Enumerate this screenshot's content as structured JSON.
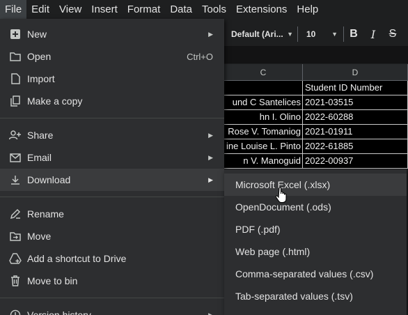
{
  "menubar": {
    "items": [
      "File",
      "Edit",
      "View",
      "Insert",
      "Format",
      "Data",
      "Tools",
      "Extensions",
      "Help"
    ]
  },
  "toolbar": {
    "font": "Default (Ari...",
    "size": "10",
    "bold": "B",
    "italic": "I",
    "strike": "S"
  },
  "grid": {
    "columns": [
      "C",
      "D"
    ],
    "header_row": [
      "",
      "Student ID Number"
    ],
    "rows": [
      [
        "und C Santelices",
        "2021-03515"
      ],
      [
        "hn I. Olino",
        "2022-60288"
      ],
      [
        "Rose V. Tomaniog",
        "2021-01911"
      ],
      [
        "ine Louise L. Pinto",
        "2022-61885"
      ],
      [
        "n V. Manoguid",
        "2022-00937"
      ]
    ]
  },
  "file_menu": {
    "new": "New",
    "open": "Open",
    "open_shortcut": "Ctrl+O",
    "import": "Import",
    "make_copy": "Make a copy",
    "share": "Share",
    "email": "Email",
    "download": "Download",
    "rename": "Rename",
    "move": "Move",
    "add_shortcut": "Add a shortcut to Drive",
    "move_to_bin": "Move to bin",
    "version_history": "Version history"
  },
  "download_menu": {
    "items": [
      "Microsoft Excel (.xlsx)",
      "OpenDocument (.ods)",
      "PDF (.pdf)",
      "Web page (.html)",
      "Comma-separated values (.csv)",
      "Tab-separated values (.tsv)"
    ]
  }
}
